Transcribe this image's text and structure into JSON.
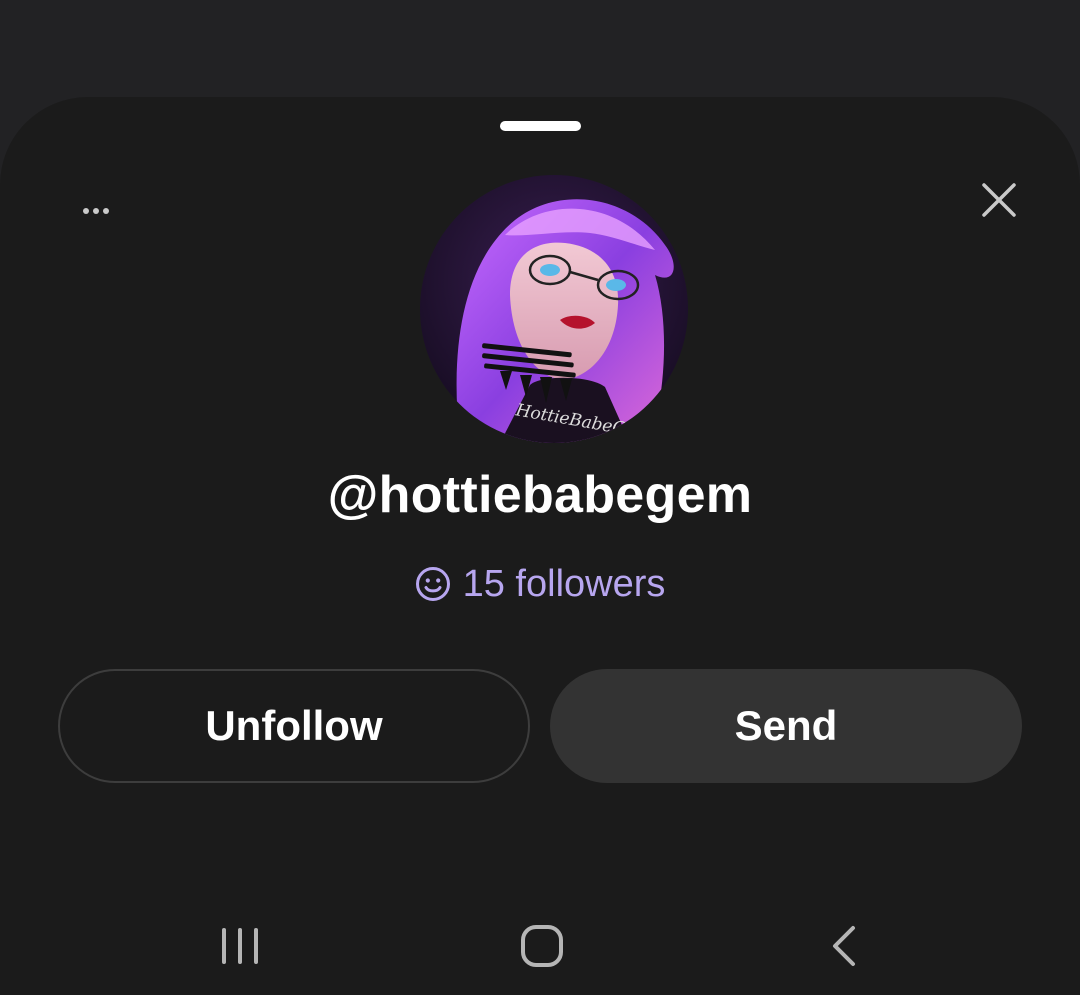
{
  "sheet": {
    "username": "@hottiebabegem",
    "followers_text": "15 followers",
    "avatar_watermark": "HottieBabeGem"
  },
  "actions": {
    "unfollow_label": "Unfollow",
    "send_label": "Send"
  },
  "icons": {
    "more": "more-horizontal-icon",
    "close": "close-icon",
    "followers": "smile-icon",
    "nav_recents": "recent-apps-icon",
    "nav_home": "home-icon",
    "nav_back": "back-icon"
  },
  "colors": {
    "background": "#222224",
    "sheet": "#1b1b1b",
    "accent_followers": "#b7a6ef",
    "send_button": "#333333",
    "unfollow_border": "#3d3d3d"
  }
}
